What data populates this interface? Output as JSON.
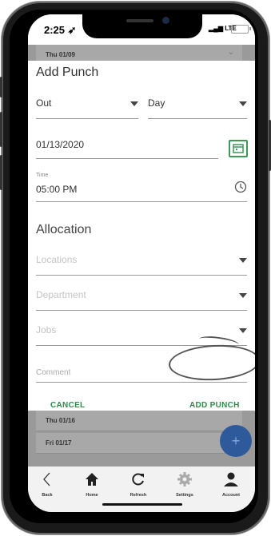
{
  "status_bar": {
    "time": "2:25",
    "network": "LTE"
  },
  "background_list": {
    "rows": [
      "Thu 01/09",
      "Thu 01/16",
      "Fri 01/17"
    ]
  },
  "dialog": {
    "title": "Add Punch",
    "punch_type": {
      "value": "Out"
    },
    "day_type": {
      "value": "Day"
    },
    "date": {
      "value": "01/13/2020"
    },
    "time": {
      "label": "Time",
      "value": "05:00 PM"
    },
    "allocation": {
      "heading": "Allocation",
      "locations_placeholder": "Locations",
      "department_placeholder": "Department",
      "jobs_placeholder": "Jobs"
    },
    "comment_placeholder": "Comment",
    "cancel_label": "CANCEL",
    "add_label": "ADD PUNCH"
  },
  "fab_label": "+",
  "nav": {
    "items": [
      {
        "label": "Back",
        "icon": "chevron-left-icon"
      },
      {
        "label": "Home",
        "icon": "home-icon"
      },
      {
        "label": "Refresh",
        "icon": "refresh-icon"
      },
      {
        "label": "Settings",
        "icon": "gear-icon"
      },
      {
        "label": "Account",
        "icon": "account-icon"
      }
    ]
  },
  "colors": {
    "accent": "#2e8b4a",
    "fab": "#2e5a9c",
    "overlay": "#9a9a9a"
  }
}
